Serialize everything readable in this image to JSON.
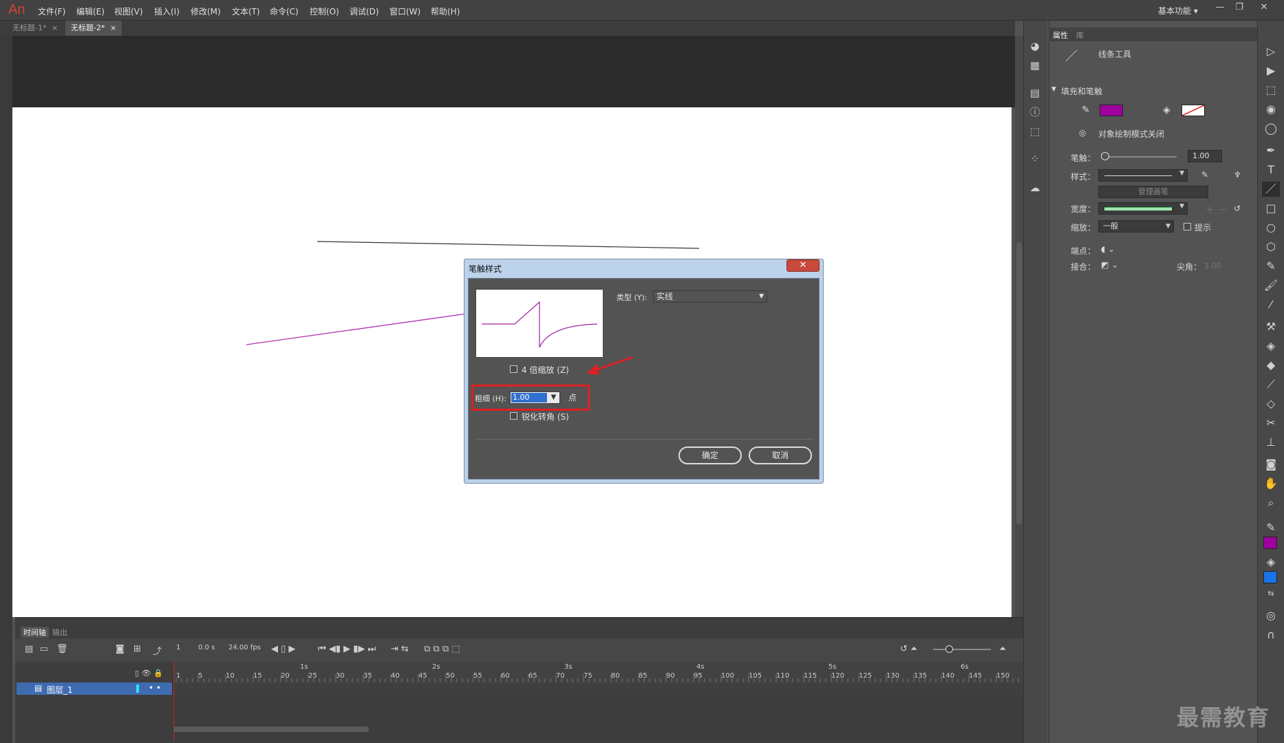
{
  "app": {
    "logo": "An",
    "workspace": "基本功能 ▾"
  },
  "menu": [
    "文件(F)",
    "编辑(E)",
    "视图(V)",
    "插入(I)",
    "修改(M)",
    "文本(T)",
    "命令(C)",
    "控制(O)",
    "调试(D)",
    "窗口(W)",
    "帮助(H)"
  ],
  "window_buttons": [
    "—",
    "❐",
    "✕"
  ],
  "doc_tabs": [
    {
      "label": "无标题-1*",
      "active": false
    },
    {
      "label": "无标题-2*",
      "active": true
    }
  ],
  "tab_close": "×",
  "properties": {
    "tabs": [
      "属性",
      "库"
    ],
    "tool_name": "线条工具",
    "section": "填充和笔触",
    "stroke_color": "#a000a0",
    "object_draw_mode": "对象绘制模式关闭",
    "stroke_label": "笔触：",
    "stroke_value": "1.00",
    "style_label": "样式：",
    "manage_brush": "管理画笔",
    "width_label": "宽度：",
    "scale_label": "缩放：",
    "scale_value": "一般",
    "hint_label": "提示",
    "cap_label": "端点：",
    "join_label": "接合：",
    "miter_label": "尖角：",
    "miter_value": "3.00"
  },
  "dialog": {
    "title": "笔触样式",
    "close": "✕",
    "type_label": "类型 (Y):",
    "type_value": "实线",
    "zoom_label": "4 倍缩放 (Z)",
    "thickness_label": "粗细 (H):",
    "thickness_value": "1.00",
    "unit": "点",
    "sharp_corners_label": "锐化转角 (S)",
    "ok": "确定",
    "cancel": "取消"
  },
  "timeline": {
    "tabs": [
      "时间轴",
      "输出"
    ],
    "frame": "1",
    "time": "0.0 s",
    "fps": "24.00 fps",
    "seconds": [
      "1s",
      "2s",
      "3s",
      "4s",
      "5s",
      "6s"
    ],
    "frame_ticks": [
      "1",
      "5",
      "10",
      "15",
      "20",
      "25",
      "30",
      "35",
      "40",
      "45",
      "50",
      "55",
      "60",
      "65",
      "70",
      "75",
      "80",
      "85",
      "90",
      "95",
      "100",
      "105",
      "110",
      "115",
      "120",
      "125",
      "130",
      "135",
      "140",
      "145",
      "150"
    ],
    "layer_name": "图层_1"
  },
  "colors": {
    "stage": "#ffffff",
    "line_black": "#333333",
    "line_purple": "#b030b0",
    "accent": "#3070d0",
    "highlight": "#e02020"
  },
  "watermark": "最需教育"
}
